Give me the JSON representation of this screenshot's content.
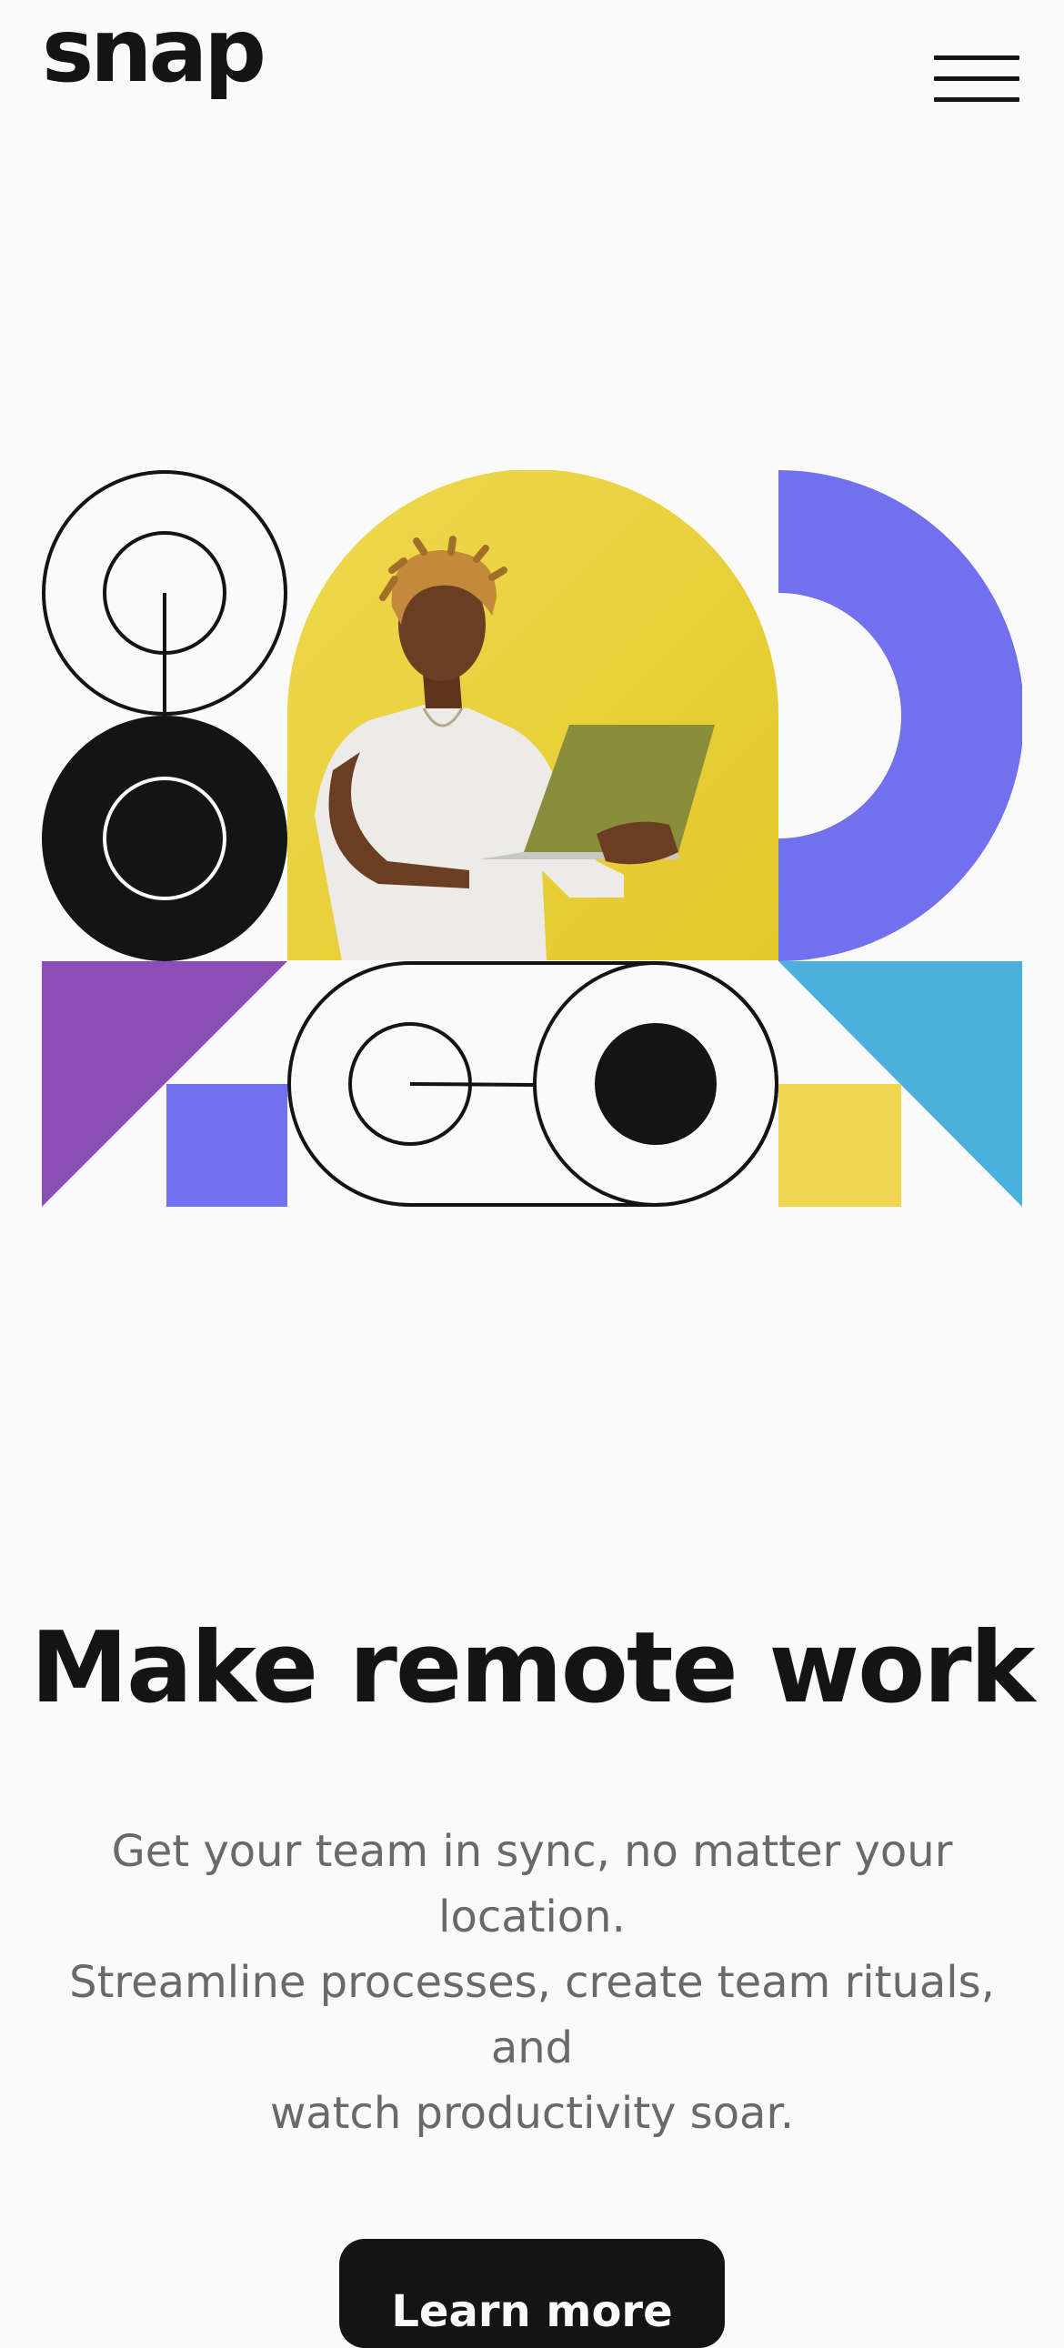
{
  "header": {
    "logo_text": "snap",
    "menu_icon": "hamburger-menu-icon"
  },
  "hero": {
    "image_alt": "Person holding a laptop in front of a yellow wall surrounded by geometric shapes",
    "colors": {
      "black": "#141414",
      "yellow": "#e9cf33",
      "violet": "#7270ef",
      "purple": "#8c4db7",
      "blue": "#4cb0dc",
      "light_yellow": "#f0d452"
    }
  },
  "main": {
    "headline": "Make remote work",
    "description_lines": [
      "Get your team in sync, no matter your",
      "location.",
      "Streamline processes, create team rituals,",
      "and",
      "watch productivity soar."
    ],
    "cta_label": "Learn more"
  }
}
